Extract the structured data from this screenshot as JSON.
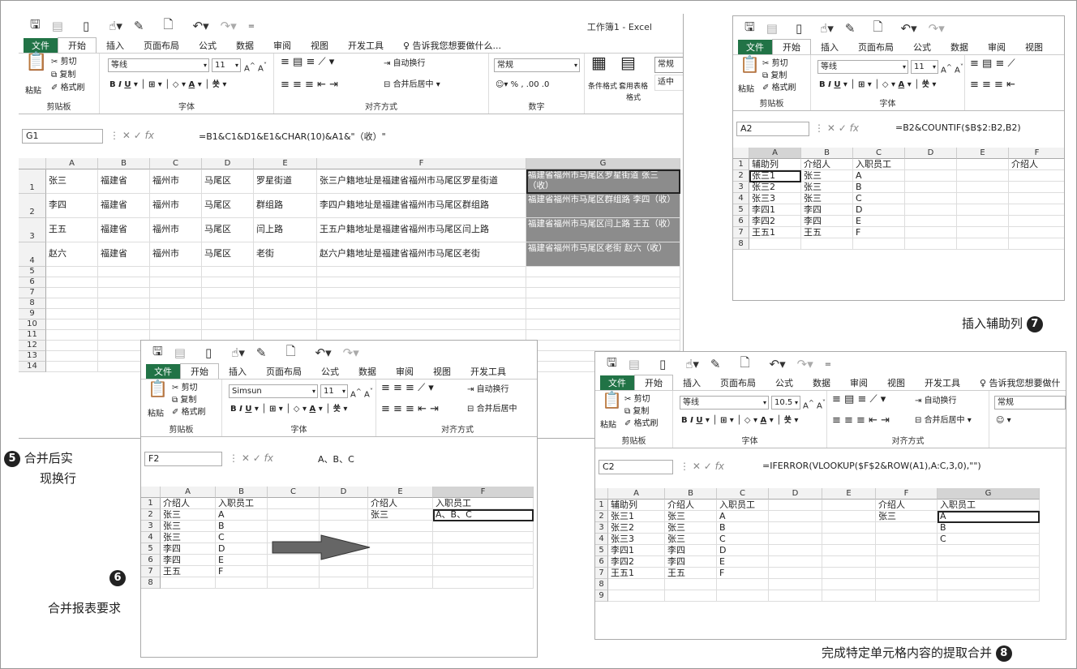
{
  "tabs": [
    "文件",
    "开始",
    "插入",
    "页面布局",
    "公式",
    "数据",
    "审阅",
    "视图",
    "开发工具"
  ],
  "qat_icons": [
    "save-icon",
    "open-icon",
    "new-icon",
    "touch-icon",
    "brush-icon",
    "preview-icon",
    "undo-icon",
    "redo-icon"
  ],
  "win1": {
    "title": "工作簿1 - Excel",
    "tellme": "♀ 告诉我您想要做什么...",
    "clipboard": {
      "cut": "剪切",
      "copy": "复制",
      "painter": "格式刷",
      "paste": "粘贴",
      "group": "剪贴板"
    },
    "font": {
      "name": "等线",
      "size": "11",
      "group": "字体",
      "grow": "A^",
      "shrink": "A˅"
    },
    "align": {
      "wrap": "自动换行",
      "merge": "合并后居中",
      "group": "对齐方式"
    },
    "number": {
      "format": "常规",
      "group": "数字",
      "percent": "%",
      "comma": ","
    },
    "styles": {
      "cond": "条件格式",
      "table": "套用表格格式",
      "normal": "常规",
      "medium": "适中"
    },
    "namebox": "G1",
    "formula": "=B1&C1&D1&E1&CHAR(10)&A1&\"（收）\"",
    "cols": [
      "A",
      "B",
      "C",
      "D",
      "E",
      "F",
      "G"
    ],
    "rows": [
      "1",
      "2",
      "3",
      "4",
      "5",
      "6",
      "7",
      "8",
      "9",
      "10",
      "11",
      "12",
      "13",
      "14"
    ],
    "data": [
      [
        "张三",
        "福建省",
        "福州市",
        "马尾区",
        "罗星街道",
        "张三户籍地址是福建省福州市马尾区罗星街道",
        "福建省福州市马尾区罗星街道 张三（收）"
      ],
      [
        "李四",
        "福建省",
        "福州市",
        "马尾区",
        "群组路",
        "李四户籍地址是福建省福州市马尾区群组路",
        "福建省福州市马尾区群组路 李四（收）"
      ],
      [
        "王五",
        "福建省",
        "福州市",
        "马尾区",
        "闫上路",
        "王五户籍地址是福建省福州市马尾区闫上路",
        "福建省福州市马尾区闫上路 王五（收）"
      ],
      [
        "赵六",
        "福建省",
        "福州市",
        "马尾区",
        "老街",
        "赵六户籍地址是福建省福州市马尾区老街",
        "福建省福州市马尾区老街 赵六（收）"
      ]
    ]
  },
  "win2": {
    "font": {
      "name": "Simsun",
      "size": "11"
    },
    "namebox": "F2",
    "formula": "A、B、C",
    "cols": [
      "A",
      "B",
      "C",
      "D",
      "E",
      "F"
    ],
    "rows": [
      "1",
      "2",
      "3",
      "4",
      "5",
      "6",
      "7",
      "8"
    ],
    "data": [
      [
        "介绍人",
        "入职员工",
        "",
        "",
        "介绍人",
        "入职员工"
      ],
      [
        "张三",
        "A",
        "",
        "",
        "张三",
        "A、B、C"
      ],
      [
        "张三",
        "B",
        "",
        "",
        "",
        ""
      ],
      [
        "张三",
        "C",
        "",
        "",
        "",
        ""
      ],
      [
        "李四",
        "D",
        "",
        "",
        "",
        ""
      ],
      [
        "李四",
        "E",
        "",
        "",
        "",
        ""
      ],
      [
        "王五",
        "F",
        "",
        "",
        "",
        ""
      ],
      [
        "",
        "",
        "",
        "",
        "",
        ""
      ]
    ]
  },
  "win3": {
    "font": {
      "name": "等线",
      "size": "11"
    },
    "namebox": "A2",
    "formula": "=B2&COUNTIF($B$2:B2,B2)",
    "cols": [
      "A",
      "B",
      "C",
      "D",
      "E",
      "F"
    ],
    "rows": [
      "1",
      "2",
      "3",
      "4",
      "5",
      "6",
      "7",
      "8"
    ],
    "data": [
      [
        "辅助列",
        "介绍人",
        "入职员工",
        "",
        "",
        "介绍人"
      ],
      [
        "张三1",
        "张三",
        "A",
        "",
        "",
        ""
      ],
      [
        "张三2",
        "张三",
        "B",
        "",
        "",
        ""
      ],
      [
        "张三3",
        "张三",
        "C",
        "",
        "",
        ""
      ],
      [
        "李四1",
        "李四",
        "D",
        "",
        "",
        ""
      ],
      [
        "李四2",
        "李四",
        "E",
        "",
        "",
        ""
      ],
      [
        "王五1",
        "王五",
        "F",
        "",
        "",
        ""
      ],
      [
        "",
        "",
        "",
        "",
        "",
        ""
      ]
    ]
  },
  "win4": {
    "font": {
      "name": "等线",
      "size": "10.5"
    },
    "tellme": "♀ 告诉我您想要做什",
    "namebox": "C2",
    "formula": "=IFERROR(VLOOKUP($F$2&ROW(A1),A:C,3,0),\"\")",
    "cols": [
      "A",
      "B",
      "C",
      "D",
      "E",
      "F",
      "G"
    ],
    "rows": [
      "1",
      "2",
      "3",
      "4",
      "5",
      "6",
      "7",
      "8",
      "9"
    ],
    "data": [
      [
        "辅助列",
        "介绍人",
        "入职员工",
        "",
        "",
        "介绍人",
        "入职员工"
      ],
      [
        "张三1",
        "张三",
        "A",
        "",
        "",
        "张三",
        "A"
      ],
      [
        "张三2",
        "张三",
        "B",
        "",
        "",
        "",
        "B"
      ],
      [
        "张三3",
        "张三",
        "C",
        "",
        "",
        "",
        "C"
      ],
      [
        "李四1",
        "李四",
        "D",
        "",
        "",
        "",
        ""
      ],
      [
        "李四2",
        "李四",
        "E",
        "",
        "",
        "",
        ""
      ],
      [
        "王五1",
        "王五",
        "F",
        "",
        "",
        "",
        ""
      ],
      [
        "",
        "",
        "",
        "",
        "",
        "",
        ""
      ],
      [
        "",
        "",
        "",
        "",
        "",
        "",
        ""
      ]
    ]
  },
  "captions": {
    "c5_line1": "合并后实",
    "c5_line2": "现换行",
    "n5": "5",
    "c6": "合并报表要求",
    "n6": "6",
    "c7": "插入辅助列",
    "n7": "7",
    "c8": "完成特定单元格内容的提取合并",
    "n8": "8"
  }
}
